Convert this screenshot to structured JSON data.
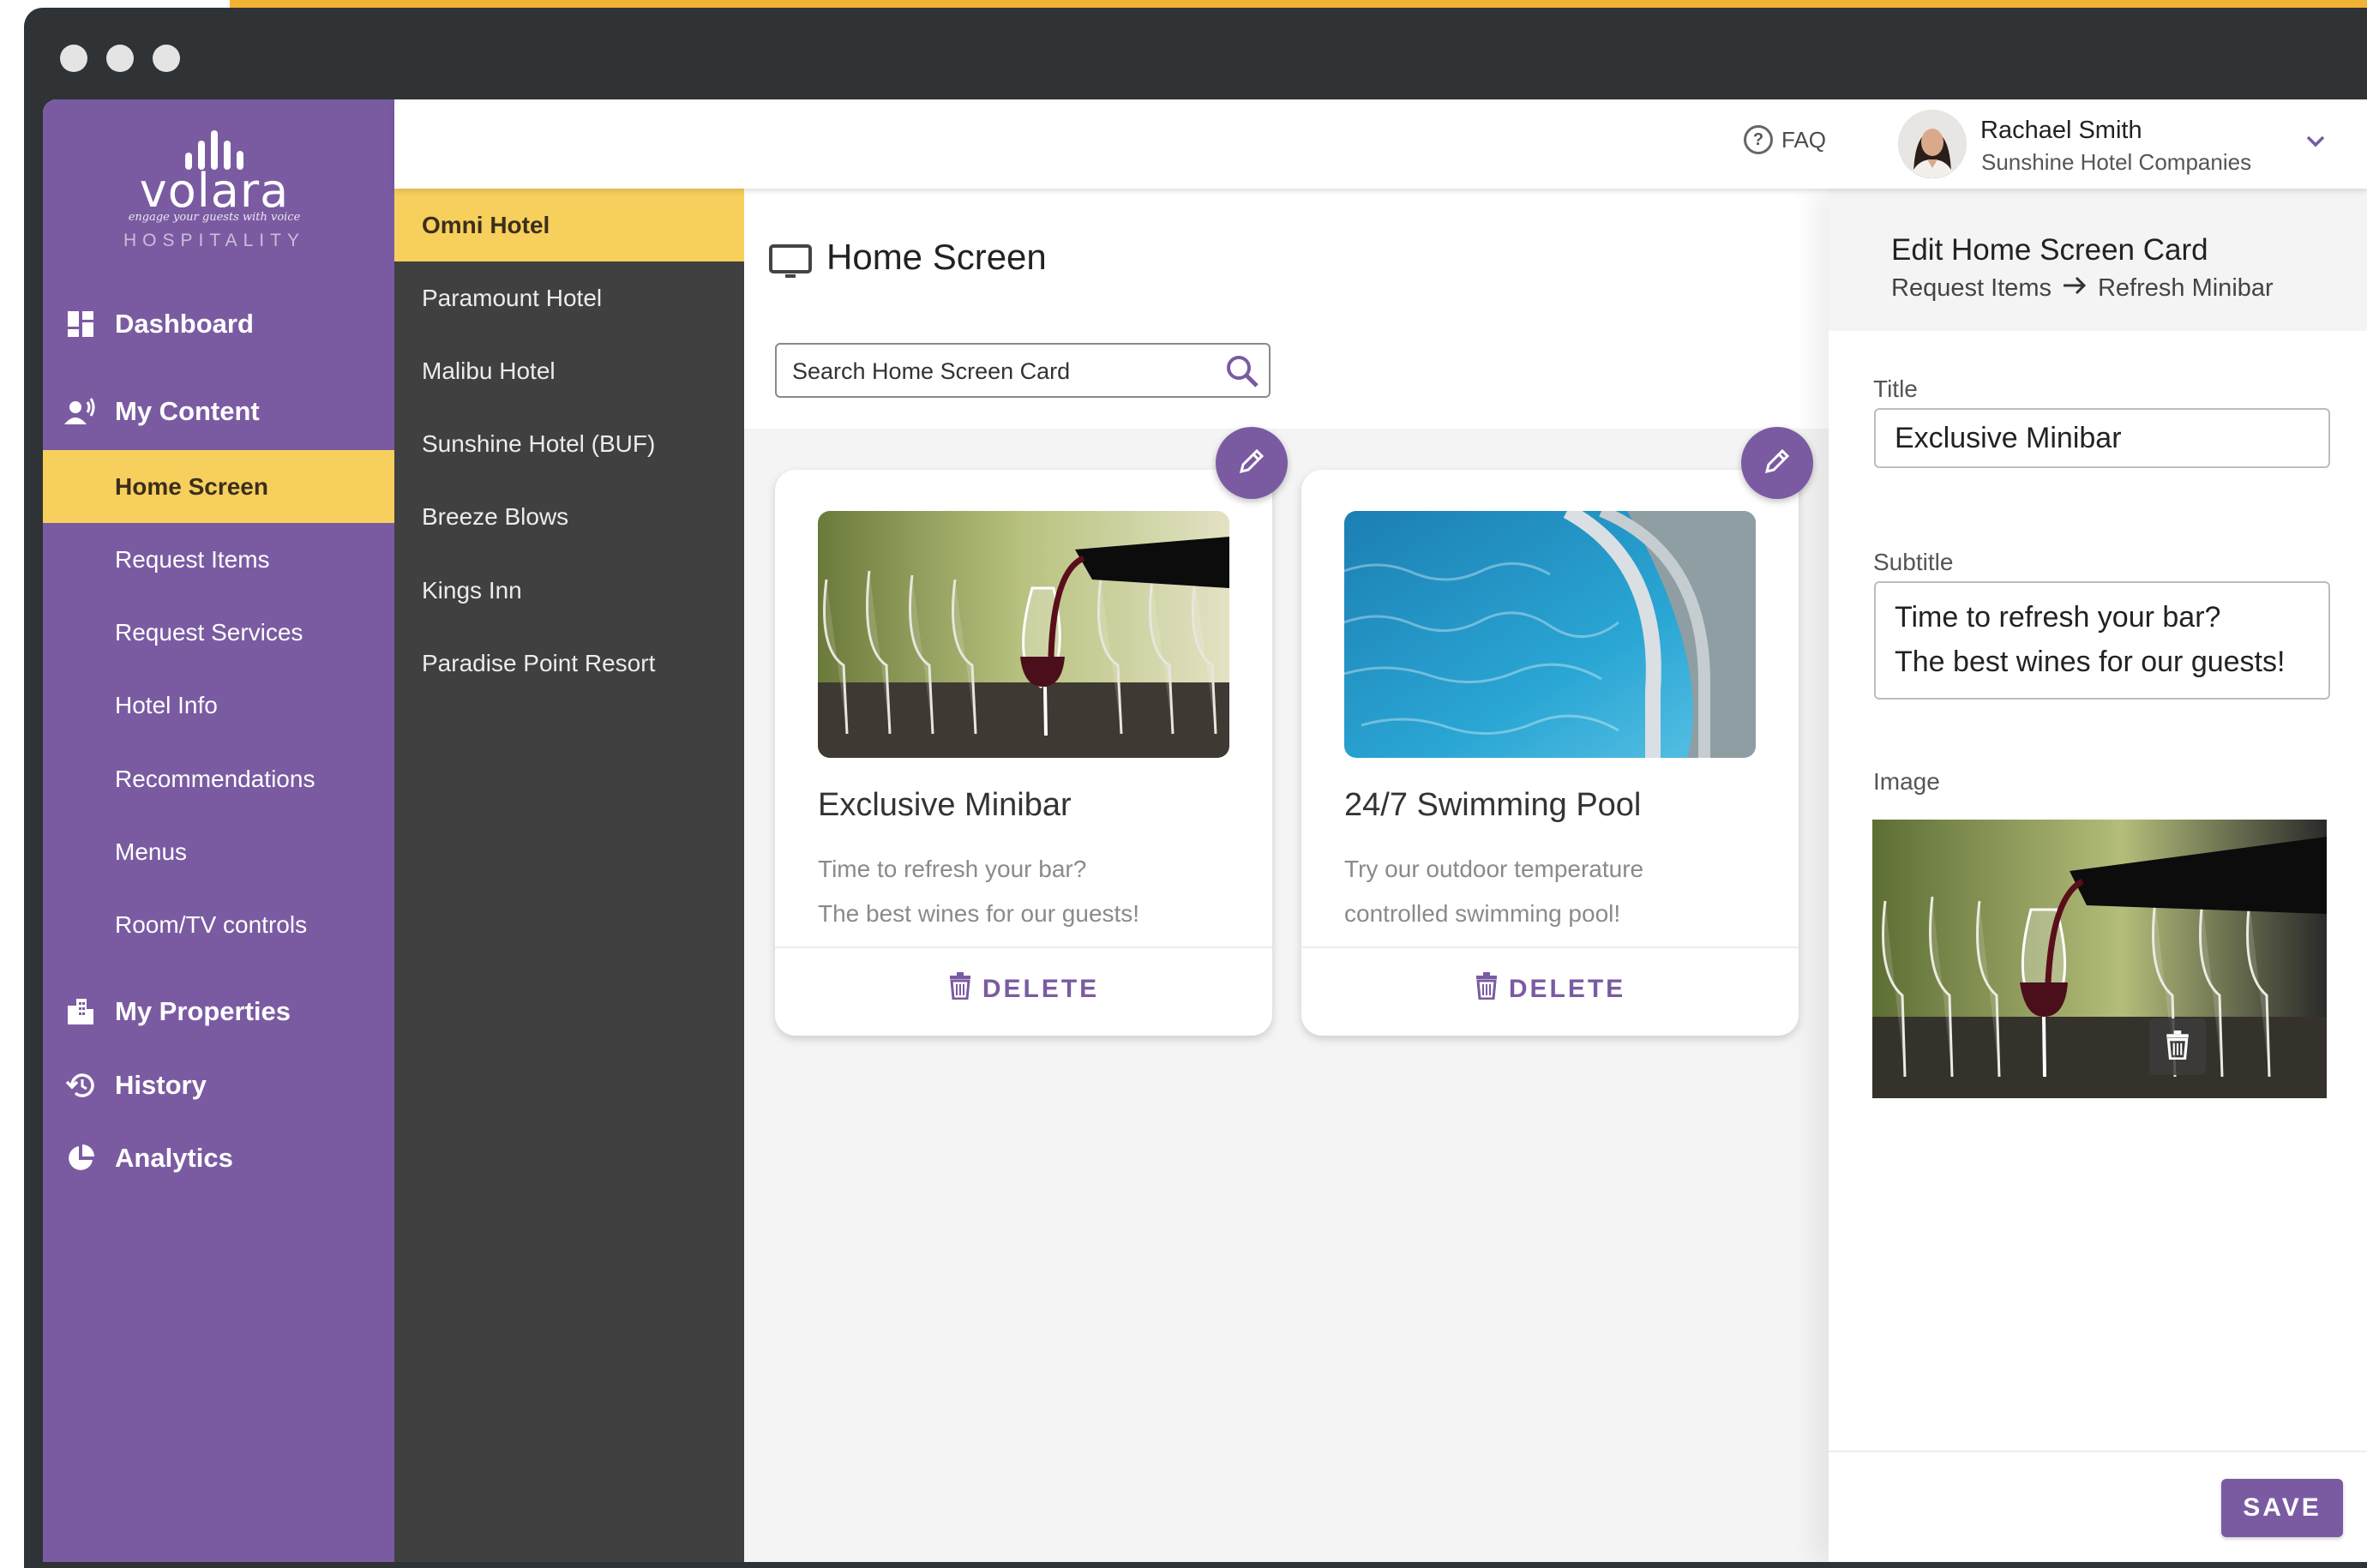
{
  "brand": {
    "logo_word": "volara",
    "logo_tagline": "engage your guests with voice",
    "logo_subtitle": "HOSPITALITY",
    "purple": "#7A5BA2",
    "yellow": "#F7CF5C"
  },
  "sidebar": {
    "main_items": [
      {
        "label": "Dashboard",
        "icon": "dashboard-icon"
      },
      {
        "label": "My Content",
        "icon": "voice-user-icon"
      },
      {
        "label": "My Properties",
        "icon": "building-icon"
      },
      {
        "label": "History",
        "icon": "history-icon"
      },
      {
        "label": "Analytics",
        "icon": "pie-chart-icon"
      }
    ],
    "sub_items": [
      {
        "label": "Home Screen",
        "active": true
      },
      {
        "label": "Request Items"
      },
      {
        "label": "Request Services"
      },
      {
        "label": "Hotel Info"
      },
      {
        "label": "Recommendations"
      },
      {
        "label": "Menus"
      },
      {
        "label": "Room/TV controls"
      }
    ]
  },
  "hotels": [
    {
      "label": "Omni Hotel",
      "active": true
    },
    {
      "label": "Paramount Hotel"
    },
    {
      "label": "Malibu Hotel"
    },
    {
      "label": "Sunshine Hotel (BUF)"
    },
    {
      "label": "Breeze Blows"
    },
    {
      "label": "Kings Inn"
    },
    {
      "label": "Paradise Point Resort"
    }
  ],
  "header": {
    "faq_label": "FAQ",
    "user_name": "Rachael Smith",
    "user_org": "Sunshine Hotel Companies"
  },
  "content": {
    "title": "Home Screen",
    "search_placeholder": "Search Home Screen Card",
    "cards": [
      {
        "title": "Exclusive Minibar",
        "subtitle_lines": [
          "Time to refresh your bar?",
          "The best wines for our guests!"
        ],
        "delete_label": "DELETE",
        "image": "wine-pour-image"
      },
      {
        "title": "24/7 Swimming Pool",
        "subtitle_lines": [
          "Try our outdoor temperature",
          "controlled swimming pool!"
        ],
        "delete_label": "DELETE",
        "image": "swimming-pool-image"
      }
    ]
  },
  "edit_panel": {
    "title": "Edit Home Screen Card",
    "breadcrumb_from": "Request Items",
    "breadcrumb_to": "Refresh Minibar",
    "title_label": "Title",
    "title_value": "Exclusive Minibar",
    "subtitle_label": "Subtitle",
    "subtitle_lines": [
      "Time to refresh your bar?",
      "The best wines for our guests!"
    ],
    "image_label": "Image",
    "save_label": "SAVE"
  }
}
